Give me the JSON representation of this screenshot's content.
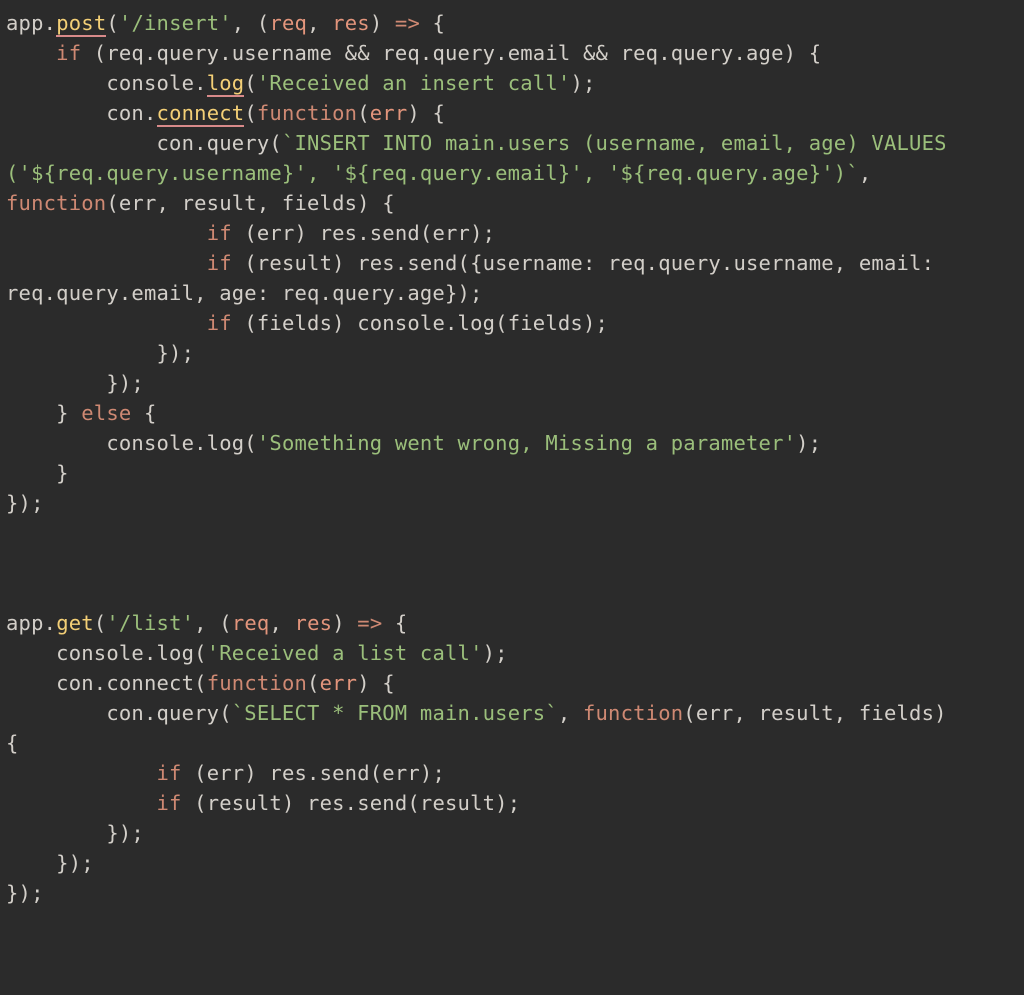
{
  "colors": {
    "background": "#2b2b2b",
    "default": "#d3cfc9",
    "method": "#f3cf76",
    "keyword": "#cf8973",
    "string": "#9bbf7b",
    "param": "#e3957c",
    "underline": "#d88a8a"
  },
  "code": {
    "app1_obj": "app",
    "dot": ".",
    "post_m": "post",
    "lpar": "(",
    "rpar": ")",
    "route_insert": "'/insert'",
    "comma_sp": ", ",
    "arrow_params_open": "(",
    "req": "req",
    "res": "res",
    "arrow_params_close": ") ",
    "arrow": "=>",
    "sp": " ",
    "lbrace": "{",
    "rbrace": "}",
    "semicolon": ";",
    "if_kw": "if",
    "else_kw": "else",
    "function_kw": "function",
    "cond_insert": " (req.query.username && req.query.email && req.query.age) ",
    "console": "console",
    "log_m": "log",
    "str_recv_insert": "'Received an insert call'",
    "con": "con",
    "connect_m": "connect",
    "err": "err",
    "query_m": "query",
    "con_dot_query_open": "con.query(",
    "sql_insert_1": "`INSERT INTO main.users (username, email, age) VALUES ",
    "sql_insert_2": "('${req.query.username}', '${req.query.email}', '${req.query.age}')`",
    "fn_params_erf": "(err, result, fields) ",
    "if_err_send": " (err) res.send(err);",
    "if_result_send_obj": " (result) res.send({username: req.query.username, email: ",
    "if_result_send_obj2": "req.query.email, age: req.query.age});",
    "if_fields_log": " (fields) console.log(fields);",
    "close_cb": "});",
    "str_missing_param": "'Something went wrong, Missing a parameter'",
    "get_m": "get",
    "route_list": "'/list'",
    "str_recv_list": "'Received a list call'",
    "sql_select": "`SELECT * FROM main.users`",
    "if_result_send_result": " (result) res.send(result);"
  }
}
